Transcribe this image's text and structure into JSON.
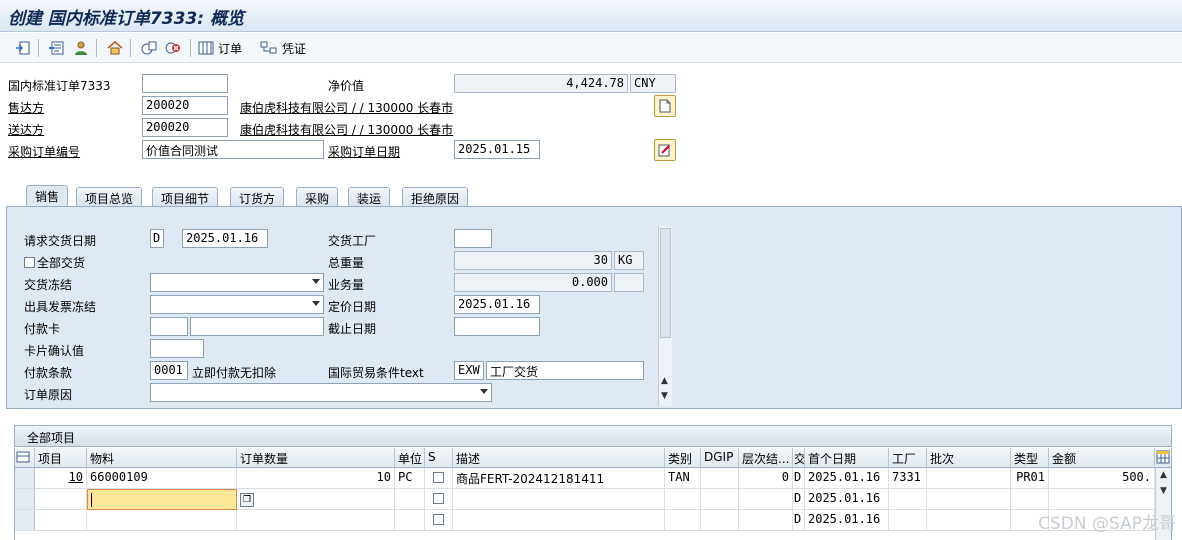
{
  "title": "创建 国内标准订单7333: 概览",
  "toolbar": {
    "order_label": "订单",
    "voucher_label": "凭证"
  },
  "header": {
    "order_label": "国内标准订单7333",
    "order_value": "",
    "net_label": "净价值",
    "net_value": "4,424.78",
    "currency": "CNY",
    "soldto_label": "售达方",
    "soldto_value": "200020",
    "soldto_text": "康伯虎科技有限公司 / / 130000 长春市",
    "shipto_label": "送达方",
    "shipto_value": "200020",
    "shipto_text": "康伯虎科技有限公司 / / 130000 长春市",
    "po_label": "采购订单编号",
    "po_value": "价值合同测试",
    "podate_label": "采购订单日期",
    "podate_value": "2025.01.15"
  },
  "tabs": [
    "销售",
    "项目总览",
    "项目细节",
    "订货方",
    "采购",
    "装运",
    "拒绝原因"
  ],
  "sales": {
    "req_date_label": "请求交货日期",
    "req_date_type": "D",
    "req_date_value": "2025.01.16",
    "plant_label": "交货工厂",
    "plant_value": "",
    "full_delivery_label": "全部交货",
    "weight_label": "总重量",
    "weight_value": "30",
    "weight_unit": "KG",
    "delivery_block_label": "交货冻结",
    "volume_label": "业务量",
    "volume_value": "0.000",
    "volume_unit": "",
    "billing_block_label": "出具发票冻结",
    "pricing_date_label": "定价日期",
    "pricing_date_value": "2025.01.16",
    "card_label": "付款卡",
    "card_value1": "",
    "card_value2": "",
    "expiry_label": "截止日期",
    "expiry_value": "",
    "card_confirm_label": "卡片确认值",
    "card_confirm_value": "",
    "payment_terms_label": "付款条款",
    "payment_terms_code": "0001",
    "payment_terms_text": "立即付款无扣除",
    "incoterms_label": "国际贸易条件text",
    "incoterms_code": "EXW",
    "incoterms_text": "工厂交货",
    "order_reason_label": "订单原因",
    "order_reason_value": ""
  },
  "items": {
    "title": "全部项目",
    "columns": [
      "项目",
      "物料",
      "订单数量",
      "单位",
      "S",
      "描述",
      "类别",
      "DGIP",
      "层次结...",
      "交",
      "首个日期",
      "工厂",
      "批次",
      "类型",
      "金额"
    ],
    "rows": [
      {
        "item": "10",
        "material": "66000109",
        "qty": "10",
        "unit": "PC",
        "desc": "商品FERT-202412181411",
        "cat": "TAN",
        "level": "0",
        "dl": "D",
        "date": "2025.01.16",
        "plant": "7331",
        "type": "PR01",
        "amount": "500."
      },
      {
        "item": "",
        "material": "",
        "qty": "",
        "unit": "",
        "desc": "",
        "cat": "",
        "level": "",
        "dl": "D",
        "date": "2025.01.16",
        "plant": "",
        "type": "",
        "amount": ""
      },
      {
        "item": "",
        "material": "",
        "qty": "",
        "unit": "",
        "desc": "",
        "cat": "",
        "level": "",
        "dl": "D",
        "date": "2025.01.16",
        "plant": "",
        "type": "",
        "amount": ""
      }
    ]
  },
  "watermark": "CSDN @SAP龙哥"
}
